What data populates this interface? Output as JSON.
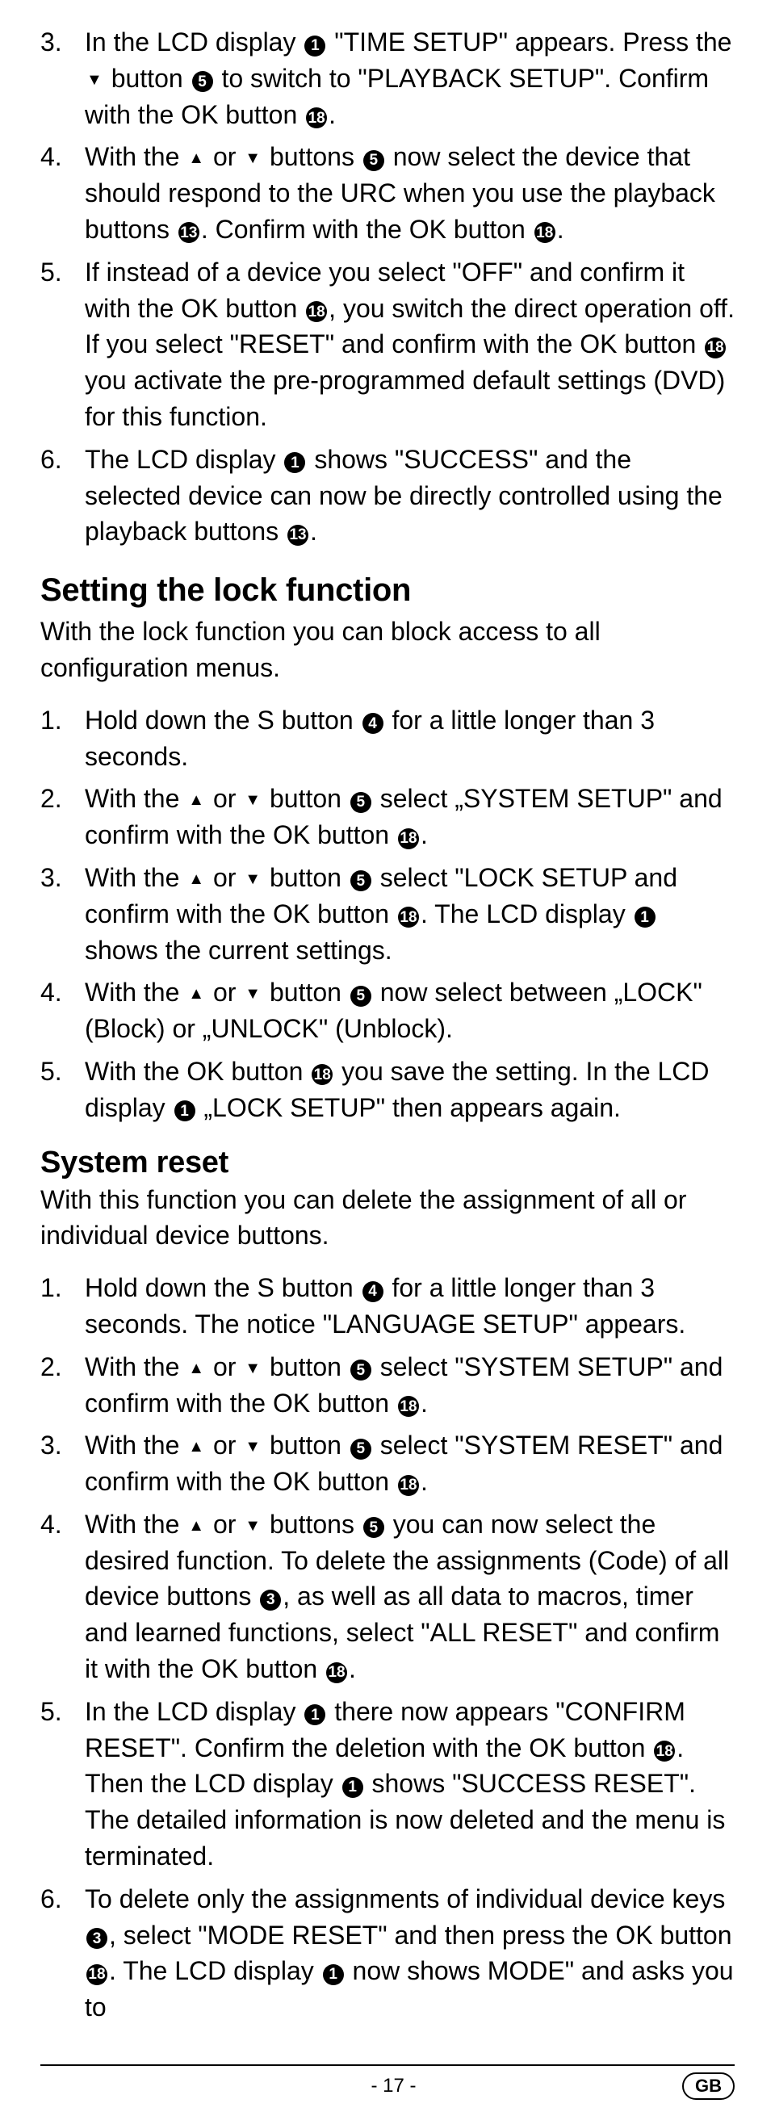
{
  "top_list": [
    {
      "n": "3.",
      "text": "In the LCD display {c1} \"TIME SETUP\" appears. Press the {down} button {c5} to switch to \"PLAYBACK SETUP\". Confirm with the OK button {c18}."
    },
    {
      "n": "4.",
      "text": "With the {up} or {down} buttons {c5} now select the device that should respond to the URC when you use the playback buttons {c13}. Confirm with the OK button {c18}."
    },
    {
      "n": "5.",
      "text": "If instead of a device you select \"OFF\" and confirm it with the OK button {c18}, you switch the direct operation off. If you select \"RESET\" and confirm with the OK button {c18} you activate the pre-programmed default settings (DVD) for this function."
    },
    {
      "n": "6.",
      "text": "The LCD display {c1} shows \"SUCCESS\" and the selected device can now be directly controlled using the playback buttons {c13}."
    }
  ],
  "lock_heading": "Setting the lock function",
  "lock_intro": "With the lock function you can block access to all configuration menus.",
  "lock_list": [
    {
      "n": "1.",
      "text": "Hold down the S button {c4} for a little longer than 3 seconds."
    },
    {
      "n": "2.",
      "text": "With the {up} or {down} button {c5} select „SYSTEM SETUP\" and confirm with the OK button {c18}."
    },
    {
      "n": "3.",
      "text": "With the {up} or {down} button {c5} select \"LOCK SETUP and confirm with the OK button {c18}. The LCD display {c1} shows the current settings."
    },
    {
      "n": "4.",
      "text": "With the {up} or {down} button {c5} now select between „LOCK\" (Block) or „UNLOCK\" (Unblock)."
    },
    {
      "n": "5.",
      "text": "With the OK button {c18} you save the setting. In the LCD display {c1} „LOCK SETUP\" then appears again."
    }
  ],
  "reset_heading": "System reset",
  "reset_intro": "With this function you can delete the assignment of all or individual device buttons.",
  "reset_list": [
    {
      "n": "1.",
      "text": "Hold down the S button {c4} for a little longer than 3 seconds. The notice \"LANGUAGE SETUP\" appears."
    },
    {
      "n": "2.",
      "text": "With the {up} or {down} button {c5} select \"SYSTEM SETUP\" and confirm with the OK button {c18}."
    },
    {
      "n": "3.",
      "text": "With the {up} or {down} button {c5} select \"SYSTEM RESET\" and confirm with the OK button {c18}."
    },
    {
      "n": "4.",
      "text": "With the {up} or {down} buttons {c5} you can now select the desired function. To delete the assignments (Code) of all device buttons {c3}, as well as all data to macros, timer and learned functions, select \"ALL RESET\" and confirm it with the OK button {c18}."
    },
    {
      "n": "5.",
      "text": "In the LCD display {c1} there now appears \"CONFIRM RESET\". Confirm the deletion with the OK button {c18}. Then the LCD display {c1} shows \"SUCCESS RESET\". The detailed information is now deleted and the menu is terminated."
    },
    {
      "n": "6.",
      "text": "To delete only the assignments of individual device keys {c3}, select \"MODE RESET\" and then press the OK button {c18}. The LCD display {c1} now shows MODE\" and asks you to"
    }
  ],
  "page_number": "- 17 -",
  "lang_badge": "GB"
}
